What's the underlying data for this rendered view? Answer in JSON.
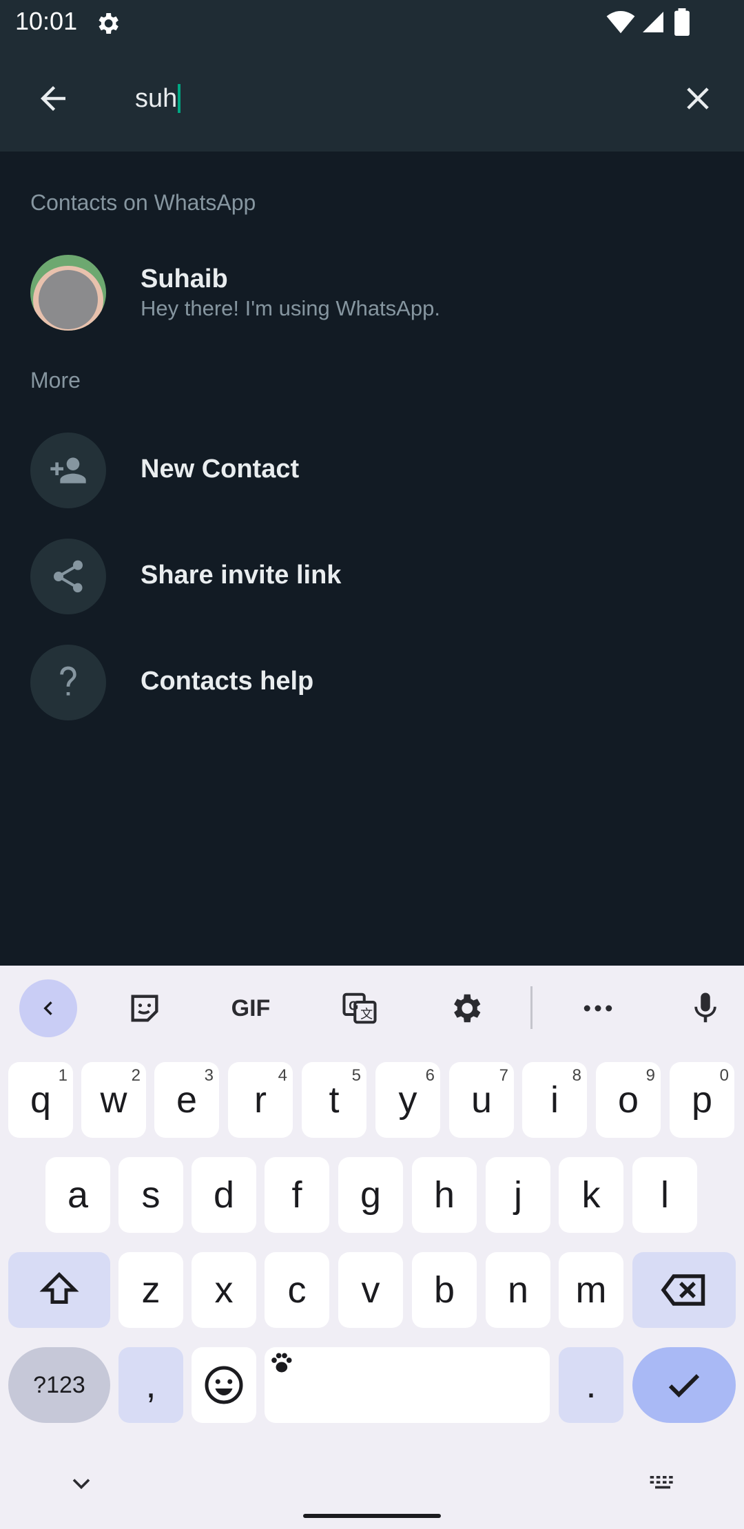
{
  "status_bar": {
    "time": "10:01"
  },
  "search": {
    "query": "suh"
  },
  "sections": {
    "contacts_title": "Contacts on WhatsApp",
    "more_title": "More"
  },
  "contact": {
    "name": "Suhaib",
    "status": "Hey there! I'm using WhatsApp."
  },
  "more_items": [
    {
      "label": "New Contact",
      "icon": "add-person-icon"
    },
    {
      "label": "Share invite link",
      "icon": "share-icon"
    },
    {
      "label": "Contacts help",
      "icon": "help-icon"
    }
  ],
  "keyboard": {
    "toolbar": [
      "back-arrow-icon",
      "sticker-icon",
      "GIF",
      "translate-icon",
      "settings-icon",
      "more-icon",
      "mic-icon"
    ],
    "gif_label": "GIF",
    "row1": [
      {
        "k": "q",
        "h": "1"
      },
      {
        "k": "w",
        "h": "2"
      },
      {
        "k": "e",
        "h": "3"
      },
      {
        "k": "r",
        "h": "4"
      },
      {
        "k": "t",
        "h": "5"
      },
      {
        "k": "y",
        "h": "6"
      },
      {
        "k": "u",
        "h": "7"
      },
      {
        "k": "i",
        "h": "8"
      },
      {
        "k": "o",
        "h": "9"
      },
      {
        "k": "p",
        "h": "0"
      }
    ],
    "row2": [
      "a",
      "s",
      "d",
      "f",
      "g",
      "h",
      "j",
      "k",
      "l"
    ],
    "row3": [
      "z",
      "x",
      "c",
      "v",
      "b",
      "n",
      "m"
    ],
    "symbols_label": "?123",
    "comma": ",",
    "period": "."
  },
  "colors": {
    "background": "#121b24",
    "appbar": "#1f2c34",
    "accent": "#00a884",
    "keyboard_bg": "#f0eef5",
    "key_special": "#d8dcf5"
  }
}
